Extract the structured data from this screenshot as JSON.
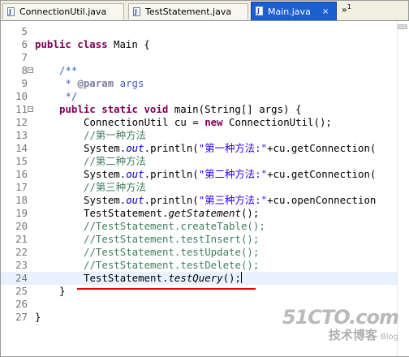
{
  "tabs": [
    {
      "label": "ConnectionUtil.java",
      "close": "×"
    },
    {
      "label": "TestStatement.java",
      "close": "×"
    },
    {
      "label": "Main.java",
      "close": "×"
    }
  ],
  "tab_overflow": {
    "symbol": "»",
    "count": "1"
  },
  "editor": {
    "line_numbers": [
      "5",
      "6",
      "7",
      "8",
      "9",
      "10",
      "11",
      "12",
      "13",
      "14",
      "15",
      "16",
      "17",
      "18",
      "19",
      "20",
      "21",
      "22",
      "23",
      "24",
      "25",
      "26",
      "27"
    ],
    "lines": {
      "l5": "",
      "l6_kw1": "public",
      "l6_kw2": "class",
      "l6_rest": " Main {",
      "l8": "/**",
      "l9_pre": " * ",
      "l9_tag": "@param",
      "l9_rest": " args",
      "l10": " */",
      "l11_kw1": "public",
      "l11_kw2": "static",
      "l11_kw3": "void",
      "l11_rest": " main(String[] args) {",
      "l12_pre": "ConnectionUtil cu = ",
      "l12_kw": "new",
      "l12_post": " ConnectionUtil();",
      "l13": "//第一种方法",
      "l14_pre": "System.",
      "l14_out": "out",
      "l14_mid": ".println(",
      "l14_str": "\"第一种方法:\"",
      "l14_post": "+cu.getConnection(",
      "l15": "//第二种方法",
      "l16_pre": "System.",
      "l16_out": "out",
      "l16_mid": ".println(",
      "l16_str": "\"第二种方法:\"",
      "l16_post": "+cu.getConnection(",
      "l17": "//第三种方法",
      "l18_pre": "System.",
      "l18_out": "out",
      "l18_mid": ".println(",
      "l18_str": "\"第三种方法:\"",
      "l18_post": "+cu.openConnection",
      "l19_pre": "TestStatement.",
      "l19_m": "getStatement",
      "l19_post": "();",
      "l20": "//TestStatement.createTable();",
      "l21": "//TestStatement.testInsert();",
      "l22": "//TestStatement.testUpdate();",
      "l23": "//TestStatement.testDelete();",
      "l24_pre": "TestStatement.",
      "l24_m": "testQuery",
      "l24_post": "();",
      "l25": "}",
      "l27": "}"
    }
  },
  "watermark": {
    "line1": "51CTO.com",
    "line2": "技术博客",
    "line3": "Blog"
  },
  "colors": {
    "keyword": "#7f0055",
    "comment": "#3f7f5f",
    "string": "#2a00ff",
    "javadoc": "#3f5fbf",
    "active_tab": "#1c5fd0",
    "underline": "#e00000"
  }
}
